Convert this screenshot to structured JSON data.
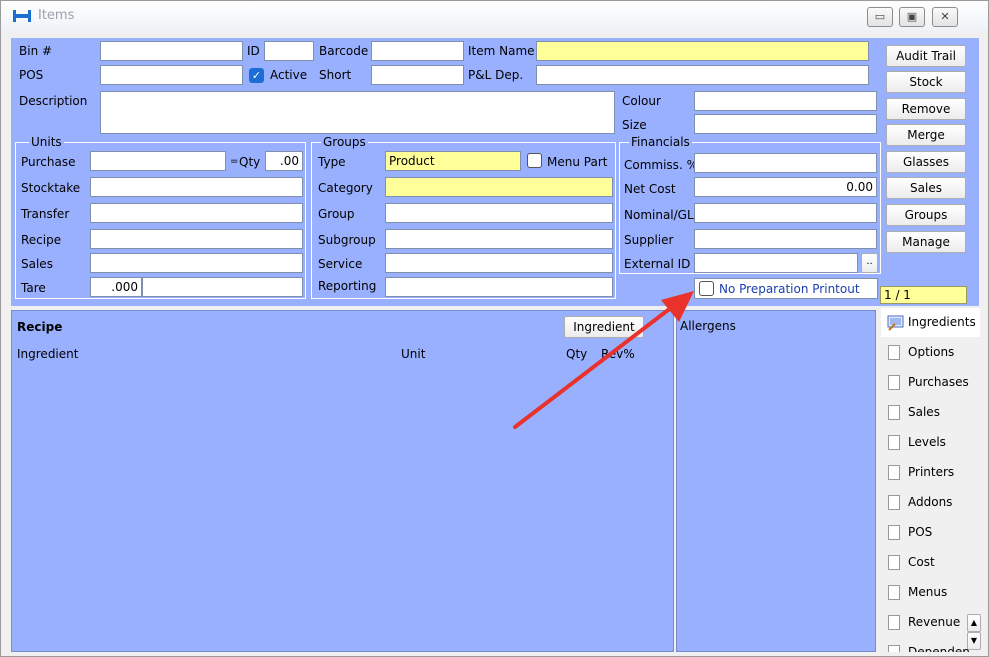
{
  "window": {
    "title": "Items",
    "min_glyph": "▭",
    "max_glyph": "▣",
    "close_glyph": "✕"
  },
  "form": {
    "bin_label": "Bin #",
    "id_label": "ID",
    "barcode_label": "Barcode",
    "item_name_label": "Item Name",
    "pos_label": "POS",
    "active_label": "Active",
    "short_label": "Short",
    "pl_dep_label": "P&L Dep.",
    "description_label": "Description",
    "colour_label": "Colour",
    "size_label": "Size"
  },
  "units": {
    "title": "Units",
    "purchase_label": "Purchase",
    "eq_sign": "=",
    "qty_label": "Qty",
    "qty_value": ".00",
    "stocktake_label": "Stocktake",
    "transfer_label": "Transfer",
    "recipe_label": "Recipe",
    "sales_label": "Sales",
    "tare_label": "Tare",
    "tare_value": ".000"
  },
  "groups": {
    "title": "Groups",
    "type_label": "Type",
    "type_value": "Product",
    "menu_part_label": "Menu Part",
    "category_label": "Category",
    "group_label": "Group",
    "subgroup_label": "Subgroup",
    "service_label": "Service",
    "reporting_label": "Reporting"
  },
  "financials": {
    "title": "Financials",
    "commiss_label": "Commiss. %",
    "net_cost_label": "Net Cost",
    "net_cost_value": "0.00",
    "nominal_label": "Nominal/GL",
    "supplier_label": "Supplier",
    "external_id_label": "External ID",
    "ellipsis": "..",
    "no_prep_label": "No Preparation Printout"
  },
  "actions": [
    "Audit Trail",
    "Stock",
    "Remove",
    "Merge",
    "Glasses",
    "Sales",
    "Groups",
    "Manage"
  ],
  "record_counter": "1 / 1",
  "recipe": {
    "title": "Recipe",
    "ingredient_button": "Ingredient",
    "col_ingredient": "Ingredient",
    "col_unit": "Unit",
    "col_qty": "Qty",
    "col_rev": "Rev%"
  },
  "allergens": {
    "title": "Allergens"
  },
  "tabs": [
    "Ingredients",
    "Options",
    "Purchases",
    "Sales",
    "Levels",
    "Printers",
    "Addons",
    "POS",
    "Cost",
    "Menus",
    "Revenue",
    "Dependen"
  ],
  "scroll": {
    "up": "▲",
    "down": "▼"
  },
  "colors": {
    "panel": "#99b0ff",
    "highlight_field": "#ffff99",
    "arrow": "#e8322b"
  }
}
